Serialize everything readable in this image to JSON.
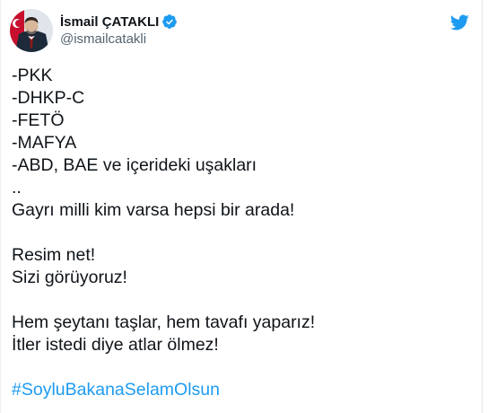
{
  "author": {
    "display_name": "İsmail ÇATAKLI",
    "handle": "@ismailcatakli",
    "verified_icon": "verified-badge-icon",
    "avatar_icon": "avatar"
  },
  "brand": {
    "logo_icon": "twitter-bird-icon",
    "accent_color": "#1d9bf0"
  },
  "tweet": {
    "lines": [
      "-PKK",
      "-DHKP-C",
      "-FETÖ",
      "-MAFYA",
      "-ABD, BAE ve içerideki uşakları",
      "..",
      "Gayrı milli kim varsa hepsi bir arada!",
      "",
      "Resim net!",
      "Sizi görüyoruz!",
      "",
      "Hem şeytanı taşlar, hem tavafı yaparız!",
      "İtler istedi diye atlar ölmez!",
      ""
    ],
    "hashtag": "#SoyluBakanaSelamOlsun"
  }
}
